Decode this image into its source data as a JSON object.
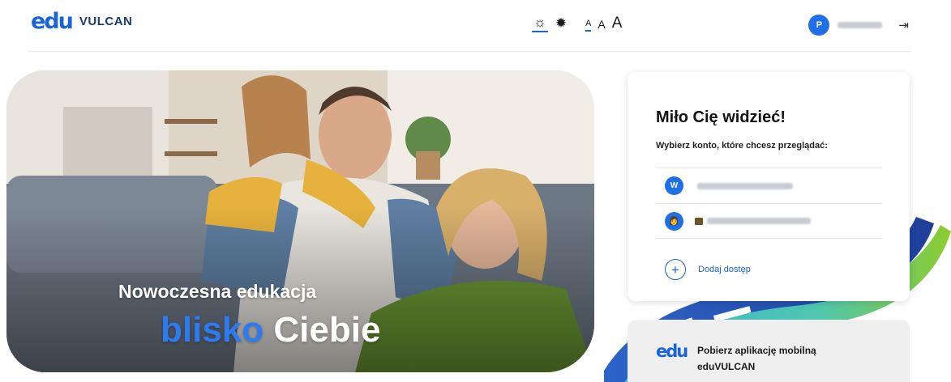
{
  "header": {
    "logo_mark": "eduˇ",
    "logo_text": "VULCAN",
    "theme": {
      "light_icon": "sun-outline-icon",
      "dark_icon": "sun-filled-icon",
      "active": "light"
    },
    "font_sizes": [
      "A",
      "A",
      "A"
    ],
    "user": {
      "avatar_initial": "P"
    },
    "logout_icon": "logout-icon"
  },
  "hero": {
    "line1": "Nowoczesna edukacja",
    "line2_accent": "blisko",
    "line2_rest": "Ciebie"
  },
  "card": {
    "title": "Miło Cię widzieć!",
    "subtitle": "Wybierz konto, które chcesz przeglądać:",
    "accounts": [
      {
        "avatar_initial": "W"
      },
      {
        "avatar_initial": "👩"
      }
    ],
    "add_access_label": "Dodaj dostęp"
  },
  "mobile_app": {
    "logo_mark": "edu",
    "line1": "Pobierz aplikację mobilną",
    "line2": "eduVULCAN"
  },
  "colors": {
    "brand": "#1b63d6",
    "accent": "#2e7bf0"
  }
}
